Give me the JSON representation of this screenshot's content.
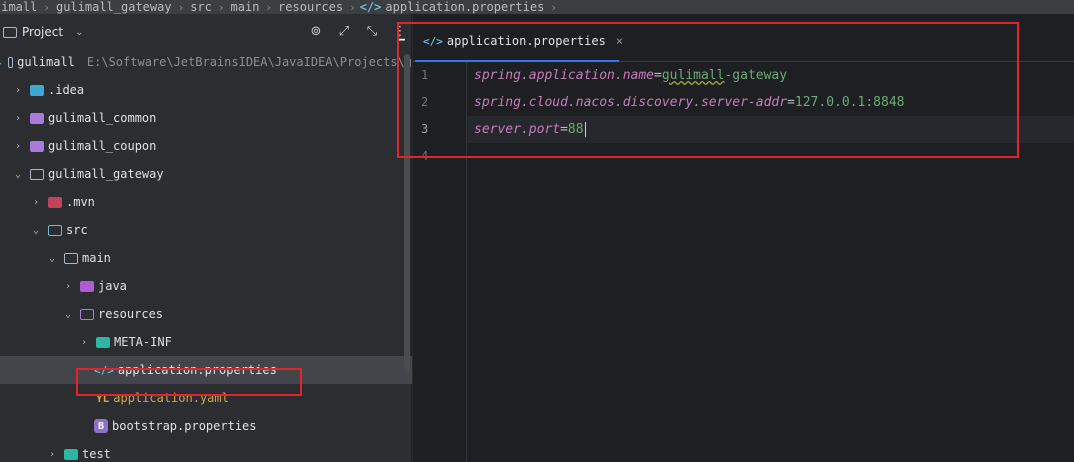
{
  "breadcrumb": {
    "items": [
      "limall",
      "gulimall_gateway",
      "src",
      "main",
      "resources"
    ],
    "file": "application.properties",
    "file_icon": "</>"
  },
  "project_panel": {
    "title": "Project",
    "caret": "⌄",
    "tools": [
      "⊚",
      "⤢",
      "⤡",
      "⋮"
    ],
    "tree": [
      {
        "label": "gulimall",
        "hint": "E:\\Software\\JetBrainsIDEA\\JavaIDEA\\Projects\\g",
        "arrow": "⌄",
        "icon": "folder-plain",
        "depth": 0
      },
      {
        "label": ".idea",
        "arrow": "›",
        "icon": "folder-blue",
        "depth": 1
      },
      {
        "label": "gulimall_common",
        "arrow": "›",
        "icon": "folder-purple",
        "depth": 1
      },
      {
        "label": "gulimall_coupon",
        "arrow": "›",
        "icon": "folder-purple",
        "depth": 1
      },
      {
        "label": "gulimall_gateway",
        "arrow": "⌄",
        "icon": "folder-plain",
        "depth": 1
      },
      {
        "label": ".mvn",
        "arrow": "›",
        "icon": "folder-red",
        "depth": 2
      },
      {
        "label": "src",
        "arrow": "⌄",
        "icon": "folder-src",
        "depth": 2
      },
      {
        "label": "main",
        "arrow": "⌄",
        "icon": "folder-plain",
        "depth": 3
      },
      {
        "label": "java",
        "arrow": "›",
        "icon": "folder-java",
        "depth": 4
      },
      {
        "label": "resources",
        "arrow": "⌄",
        "icon": "folder-res",
        "depth": 4
      },
      {
        "label": "META-INF",
        "arrow": "›",
        "icon": "folder-teal",
        "depth": 5
      },
      {
        "label": "application.properties",
        "arrow": "",
        "icon": "file-prop",
        "depth": 5,
        "selected": true
      },
      {
        "label": "application.yaml",
        "arrow": "",
        "icon": "file-yaml",
        "depth": 5
      },
      {
        "label": "bootstrap.properties",
        "arrow": "",
        "icon": "file-boot",
        "depth": 5
      },
      {
        "label": "test",
        "arrow": "›",
        "icon": "folder-teal",
        "depth": 3
      }
    ]
  },
  "editor": {
    "tab": {
      "label": "application.properties",
      "icon": "</>",
      "close": "×"
    },
    "lines": [
      {
        "no": "1",
        "key": "spring.application.name",
        "eq": "=",
        "value_a": "gulimall",
        "value_b": "-gateway"
      },
      {
        "no": "2",
        "key": "spring.cloud.nacos.discovery.server-addr",
        "eq": "=",
        "value_a": "127.0.0.1:8848",
        "value_b": ""
      },
      {
        "no": "3",
        "key": "server.port",
        "eq": "=",
        "value_a": "88",
        "value_b": ""
      },
      {
        "no": "4",
        "key": "",
        "eq": "",
        "value_a": "",
        "value_b": ""
      }
    ]
  },
  "colors": {
    "highlight_box": "#e0262a",
    "key": "#c77dbb",
    "value": "#6aab73",
    "tab_underline": "#3574f0"
  }
}
